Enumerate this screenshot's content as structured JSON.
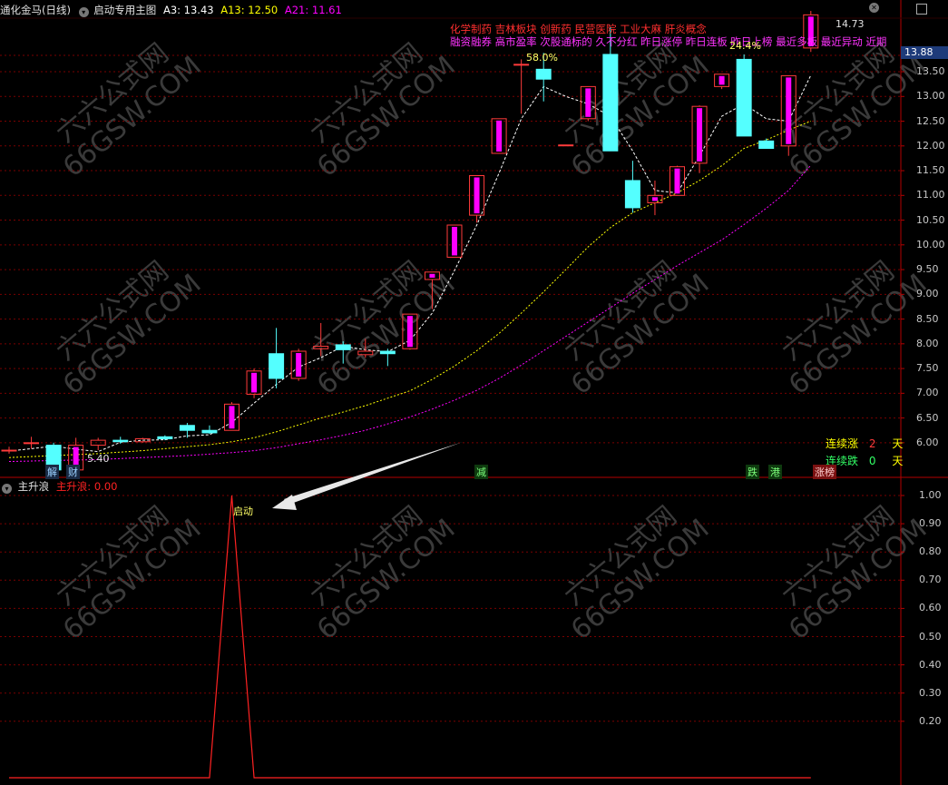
{
  "colors": {
    "background": "#000000",
    "grid": "#7a0000",
    "frame": "#b30000",
    "up": "#ff3b3b",
    "up_fill": "#ff00ff",
    "down": "#54ffff",
    "ma3": "#ffffff",
    "ma13": "#ffff00",
    "ma21": "#ff00ff",
    "main_wave": "#ff2222",
    "concept_text": "#ff2f2f",
    "tag_text": "#ff33ff",
    "current_price_bg": "#1e3b7a"
  },
  "header": {
    "stock_title": "通化金马(日线)",
    "indicator_title": "启动专用主图",
    "ma3_label": "A3: 13.43",
    "ma13_label": "A13: 12.50",
    "ma21_label": "A21: 11.61",
    "expand_icon": "chevron-down-icon",
    "close_icon": "close-icon",
    "maximize_icon": "maximize-icon"
  },
  "concepts": {
    "line1": "化学制药 吉林板块 创新药 民营医院 工业大麻 肝炎概念",
    "line2": "融资融券 高市盈率 次股通标的 久不分红 昨日涨停 昨日连板 昨日上榜 最近多板 最近异动 近期"
  },
  "price_axis": {
    "current_price": "13.88",
    "ticks": [
      "13.50",
      "13.00",
      "12.50",
      "12.00",
      "11.50",
      "11.00",
      "10.50",
      "10.00",
      "9.50",
      "9.00",
      "8.50",
      "8.00",
      "7.50",
      "7.00",
      "6.50",
      "6.00"
    ]
  },
  "annotations": {
    "high_label": "14.73",
    "low_label": "5.40",
    "pct_58": "58.0%",
    "pct_24": "24.4%"
  },
  "streak": {
    "up_label": "连续涨",
    "up_value": "2",
    "down_label": "连续跌",
    "down_value": "0",
    "unit": "天"
  },
  "event_tags": [
    "解",
    "财",
    "减",
    "跌",
    "港",
    "涨榜"
  ],
  "sub_chart": {
    "title": "主升浪",
    "value_label": "主升浪: 0.00",
    "start_label": "启动",
    "ticks": [
      "1.00",
      "0.90",
      "0.80",
      "0.70",
      "0.60",
      "0.50",
      "0.40",
      "0.30",
      "0.20"
    ]
  },
  "watermark": {
    "line1": "六六公式网",
    "line2": "66GSW.COM"
  },
  "chart_data": {
    "type": "candlestick",
    "ylim": [
      5.3,
      14.95
    ],
    "candles": [
      {
        "o": 5.85,
        "h": 5.92,
        "l": 5.78,
        "c": 5.85
      },
      {
        "o": 6.0,
        "h": 6.12,
        "l": 5.88,
        "c": 6.0
      },
      {
        "o": 5.95,
        "h": 6.0,
        "l": 5.4,
        "c": 5.45
      },
      {
        "o": 5.45,
        "h": 6.1,
        "l": 5.4,
        "c": 5.95
      },
      {
        "o": 5.95,
        "h": 6.1,
        "l": 5.85,
        "c": 6.05
      },
      {
        "o": 6.05,
        "h": 6.12,
        "l": 5.98,
        "c": 6.02
      },
      {
        "o": 6.02,
        "h": 6.1,
        "l": 6.0,
        "c": 6.08
      },
      {
        "o": 6.12,
        "h": 6.15,
        "l": 6.05,
        "c": 6.08
      },
      {
        "o": 6.35,
        "h": 6.4,
        "l": 6.1,
        "c": 6.25
      },
      {
        "o": 6.25,
        "h": 6.35,
        "l": 6.18,
        "c": 6.2
      },
      {
        "o": 6.25,
        "h": 6.82,
        "l": 6.25,
        "c": 6.78
      },
      {
        "o": 6.98,
        "h": 7.5,
        "l": 6.9,
        "c": 7.45
      },
      {
        "o": 7.8,
        "h": 8.32,
        "l": 7.1,
        "c": 7.3
      },
      {
        "o": 7.3,
        "h": 7.9,
        "l": 7.25,
        "c": 7.85
      },
      {
        "o": 7.9,
        "h": 8.42,
        "l": 7.75,
        "c": 7.95
      },
      {
        "o": 7.98,
        "h": 8.05,
        "l": 7.6,
        "c": 7.88
      },
      {
        "o": 7.78,
        "h": 8.1,
        "l": 7.72,
        "c": 7.85
      },
      {
        "o": 7.85,
        "h": 7.9,
        "l": 7.55,
        "c": 7.8
      },
      {
        "o": 7.9,
        "h": 8.6,
        "l": 7.88,
        "c": 8.6
      },
      {
        "o": 9.3,
        "h": 9.45,
        "l": 8.7,
        "c": 9.45
      },
      {
        "o": 9.75,
        "h": 10.4,
        "l": 9.75,
        "c": 10.4
      },
      {
        "o": 10.6,
        "h": 11.4,
        "l": 10.45,
        "c": 11.4
      },
      {
        "o": 11.85,
        "h": 12.55,
        "l": 11.85,
        "c": 12.55
      },
      {
        "o": 13.65,
        "h": 13.75,
        "l": 12.65,
        "c": 13.65
      },
      {
        "o": 13.55,
        "h": 13.88,
        "l": 12.9,
        "c": 13.35
      },
      {
        "o": 12.02,
        "h": 12.02,
        "l": 12.02,
        "c": 12.02
      },
      {
        "o": 12.55,
        "h": 13.2,
        "l": 12.5,
        "c": 13.2
      },
      {
        "o": 13.85,
        "h": 14.4,
        "l": 11.9,
        "c": 11.9
      },
      {
        "o": 11.3,
        "h": 11.7,
        "l": 10.65,
        "c": 10.75
      },
      {
        "o": 10.85,
        "h": 11.3,
        "l": 10.6,
        "c": 11.0
      },
      {
        "o": 11.0,
        "h": 11.6,
        "l": 11.0,
        "c": 11.58
      },
      {
        "o": 11.65,
        "h": 12.82,
        "l": 11.45,
        "c": 12.8
      },
      {
        "o": 13.2,
        "h": 13.45,
        "l": 13.15,
        "c": 13.45
      },
      {
        "o": 13.75,
        "h": 13.85,
        "l": 12.2,
        "c": 12.2
      },
      {
        "o": 12.1,
        "h": 12.15,
        "l": 11.95,
        "c": 11.95
      },
      {
        "o": 12.0,
        "h": 13.42,
        "l": 11.8,
        "c": 13.42
      },
      {
        "o": 13.98,
        "h": 14.73,
        "l": 13.9,
        "c": 14.65
      }
    ],
    "ma3": [
      5.83,
      5.88,
      5.93,
      5.87,
      5.82,
      6.01,
      6.05,
      6.06,
      6.14,
      6.16,
      6.41,
      6.8,
      7.18,
      7.53,
      7.72,
      7.95,
      7.88,
      7.84,
      8.07,
      8.62,
      9.48,
      10.4,
      11.45,
      12.55,
      13.2,
      13.0,
      12.85,
      12.6,
      11.9,
      11.1,
      11.05,
      11.8,
      12.6,
      12.85,
      12.55,
      12.5,
      13.43
    ],
    "ma13": [
      5.7,
      5.72,
      5.74,
      5.76,
      5.78,
      5.81,
      5.84,
      5.88,
      5.92,
      5.96,
      6.02,
      6.1,
      6.22,
      6.36,
      6.5,
      6.62,
      6.75,
      6.9,
      7.05,
      7.28,
      7.55,
      7.86,
      8.21,
      8.62,
      9.05,
      9.5,
      9.96,
      10.35,
      10.65,
      10.85,
      11.05,
      11.3,
      11.6,
      11.95,
      12.12,
      12.32,
      12.5
    ],
    "ma21": [
      5.62,
      5.63,
      5.64,
      5.65,
      5.66,
      5.68,
      5.7,
      5.72,
      5.74,
      5.77,
      5.8,
      5.84,
      5.9,
      5.98,
      6.06,
      6.15,
      6.25,
      6.38,
      6.52,
      6.68,
      6.86,
      7.06,
      7.3,
      7.57,
      7.86,
      8.15,
      8.44,
      8.73,
      9.02,
      9.3,
      9.58,
      9.84,
      10.1,
      10.41,
      10.74,
      11.1,
      11.61
    ],
    "main_wave": [
      0,
      0,
      0,
      0,
      0,
      0,
      0,
      0,
      0,
      0,
      1,
      0,
      0,
      0,
      0,
      0,
      0,
      0,
      0,
      0,
      0,
      0,
      0,
      0,
      0,
      0,
      0,
      0,
      0,
      0,
      0,
      0,
      0,
      0,
      0,
      0,
      0
    ]
  }
}
